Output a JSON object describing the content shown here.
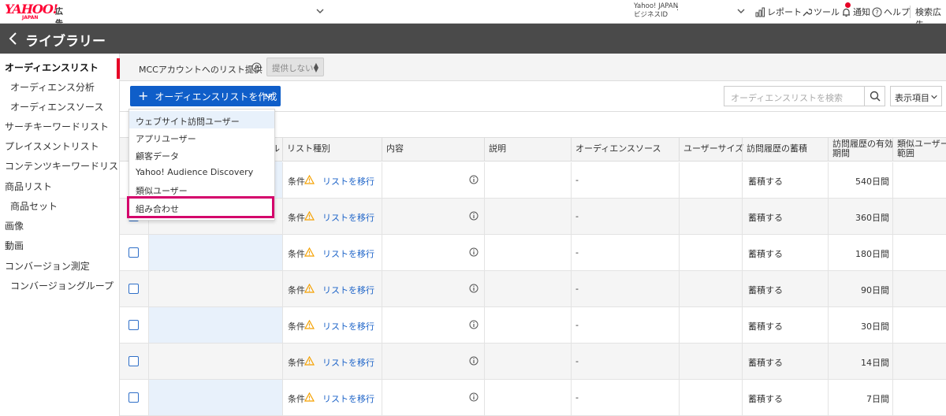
{
  "topbar": {
    "logo_brand": "YAHOO!",
    "logo_sub": "JAPAN",
    "logo_ad": "広告",
    "business_id_line1": "Yahoo! JAPAN",
    "business_id_line2": "ビジネスID",
    "business_id_colon": ":",
    "nav": {
      "report": "レポート",
      "tools": "ツール",
      "notice": "通知",
      "help": "ヘルプ",
      "search_ad": "検索広告"
    }
  },
  "header": {
    "title": "ライブラリー"
  },
  "sidebar": {
    "items": [
      {
        "label": "オーディエンスリスト",
        "sub": false,
        "active": true
      },
      {
        "label": "オーディエンス分析",
        "sub": true,
        "active": false
      },
      {
        "label": "オーディエンスソース",
        "sub": true,
        "active": false
      },
      {
        "label": "サーチキーワードリスト",
        "sub": false,
        "active": false
      },
      {
        "label": "プレイスメントリスト",
        "sub": false,
        "active": false
      },
      {
        "label": "コンテンツキーワードリスト",
        "sub": false,
        "active": false
      },
      {
        "label": "商品リスト",
        "sub": false,
        "active": false
      },
      {
        "label": "商品セット",
        "sub": true,
        "active": false
      },
      {
        "label": "画像",
        "sub": false,
        "active": false
      },
      {
        "label": "動画",
        "sub": false,
        "active": false
      },
      {
        "label": "コンバージョン測定",
        "sub": false,
        "active": false
      },
      {
        "label": "コンバージョングループ",
        "sub": true,
        "active": false
      }
    ]
  },
  "mcc": {
    "label": "MCCアカウントへのリスト提供",
    "select_value": "提供しない"
  },
  "toolbar": {
    "create_label": "オーディエンスリストを作成",
    "search_placeholder": "オーディエンスリストを検索",
    "display_items": "表示項目"
  },
  "dropdown": {
    "items": [
      "ウェブサイト訪問ユーザー",
      "アプリユーザー",
      "顧客データ",
      "Yahoo! Audience Discovery",
      "類似ユーザー",
      "組み合わせ"
    ]
  },
  "table": {
    "headers": {
      "name_tail": "ル",
      "list_type": "リスト種別",
      "content": "内容",
      "description": "説明",
      "audience_source": "オーディエンスソース",
      "user_size": "ユーザーサイズ",
      "accumulate": "訪問履歴の蓄積",
      "valid_period_1": "訪問履歴の有効",
      "valid_period_2": "期間",
      "similar_1": "類似ユーザーの",
      "similar_2": "範囲"
    },
    "rows": [
      {
        "type": "条件",
        "action": "リストを移行",
        "source": "-",
        "accumulate": "蓄積する",
        "period": "540日間"
      },
      {
        "type": "条件",
        "action": "リストを移行",
        "source": "-",
        "accumulate": "蓄積する",
        "period": "360日間"
      },
      {
        "type": "条件",
        "action": "リストを移行",
        "source": "-",
        "accumulate": "蓄積する",
        "period": "180日間"
      },
      {
        "type": "条件",
        "action": "リストを移行",
        "source": "-",
        "accumulate": "蓄積する",
        "period": "90日間"
      },
      {
        "type": "条件",
        "action": "リストを移行",
        "source": "-",
        "accumulate": "蓄積する",
        "period": "30日間"
      },
      {
        "type": "条件",
        "action": "リストを移行",
        "source": "-",
        "accumulate": "蓄積する",
        "period": "14日間"
      },
      {
        "type": "条件",
        "action": "リストを移行",
        "source": "-",
        "accumulate": "蓄積する",
        "period": "7日間"
      }
    ]
  },
  "colors": {
    "brand_red": "#ff0033",
    "primary_blue": "#0f5ec9",
    "link_blue": "#1c63c8",
    "header_gray": "#4a4a4a",
    "highlight_magenta": "#d4006b",
    "warning_orange": "#f5a100"
  }
}
